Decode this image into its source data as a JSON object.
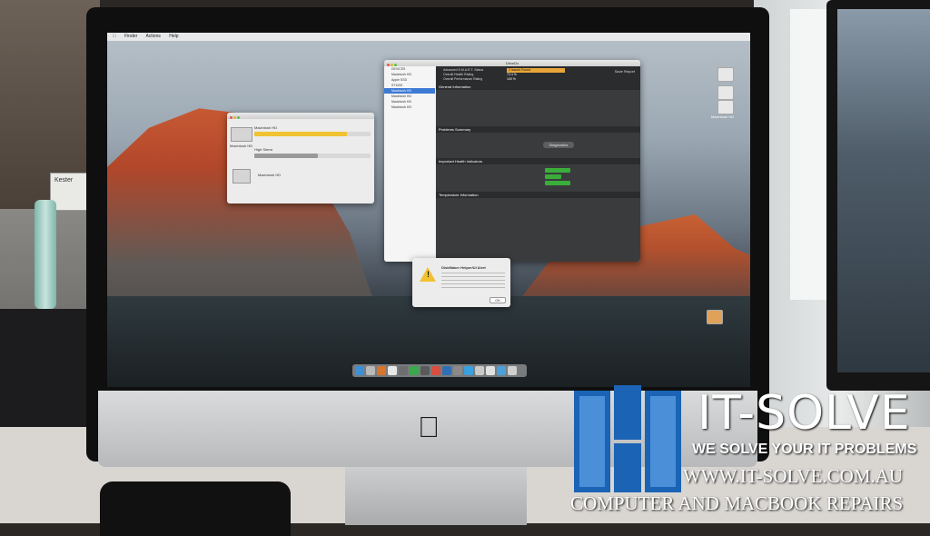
{
  "photo": {
    "room_labels": {
      "kester_box": "Kester"
    }
  },
  "screen": {
    "menubar": [
      "Finder",
      "Actions",
      "Help"
    ],
    "desktop_icons": [
      "",
      "",
      "Macintosh HD"
    ],
    "disk_window": {
      "title": "",
      "drive_label": "Macintosh HD",
      "items": [
        {
          "name": "Macintosh HD",
          "detail": "",
          "fill": 0.8
        },
        {
          "name": "High Sierra",
          "detail": "",
          "fill": 0.55
        },
        {
          "name": "Macintosh HD",
          "detail": "",
          "fill": 0.0
        }
      ]
    },
    "diag_window": {
      "title": "DriveDx",
      "sidebar": [
        "DEVICES",
        "Macintosh HD",
        "Apple SSD",
        "ST1000",
        "Macintosh HD",
        "Macintosh HD",
        "Macintosh HD",
        "Macintosh HD"
      ],
      "sidebar_selected_index": 4,
      "summary": [
        {
          "label": "Advanced S.M.A.R.T. Status",
          "value": "2 Issues Found"
        },
        {
          "label": "Overall Health Rating",
          "value": "72.4 %"
        },
        {
          "label": "Overall Performance Rating",
          "value": "100 %"
        }
      ],
      "sections": [
        "General Information",
        "Problems Summary",
        "Important Health Indicators",
        "Temperature Information"
      ],
      "diagnostics_button": "Diagnostics",
      "save_button": "Save Report"
    },
    "alert": {
      "title": "DiskMaker Helper/UI Alert",
      "ok_label": "OK"
    },
    "dock_colors": [
      "#3d8fd6",
      "#b9b9b9",
      "#d8752a",
      "#e8e8e8",
      "#6e6e6e",
      "#3aa84b",
      "#5a5a5a",
      "#d94e3e",
      "#2f6fb3",
      "#8a8a8a",
      "#3aa0e0",
      "#c9c9c9",
      "#e1e1e1",
      "#4aa0d8",
      "#d0d0d0"
    ]
  },
  "brand": {
    "name": "IT-SOLVE",
    "tagline": "WE SOLVE YOUR IT PROBLEMS",
    "url": "WWW.IT-SOLVE.COM.AU",
    "services": "COMPUTER AND MACBOOK REPAIRS",
    "accent": "#1b63b5"
  }
}
